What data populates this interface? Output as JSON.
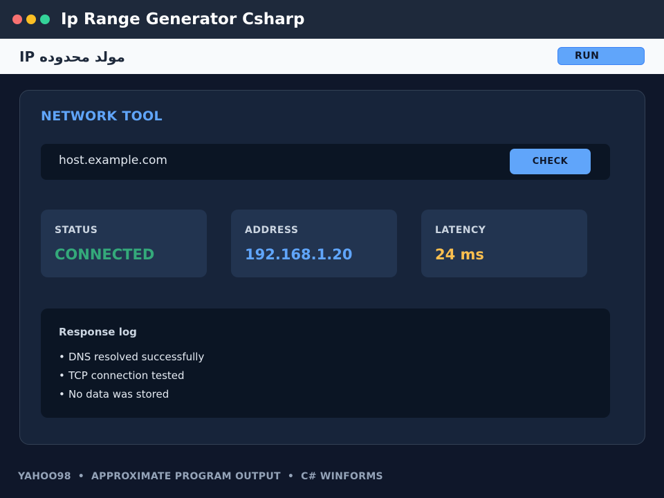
{
  "window": {
    "title": "Ip Range Generator Csharp"
  },
  "menubar": {
    "title": "مولد محدوده IP",
    "run_label": "RUN"
  },
  "panel": {
    "heading": "NETWORK TOOL",
    "host_value": "host.example.com",
    "check_label": "CHECK"
  },
  "stats": [
    {
      "label": "STATUS",
      "value": "CONNECTED",
      "color": "#34a97a"
    },
    {
      "label": "ADDRESS",
      "value": "192.168.1.20",
      "color": "#60a5fa"
    },
    {
      "label": "LATENCY",
      "value": "24 ms",
      "color": "#fbbf4f"
    }
  ],
  "log": {
    "title": "Response log",
    "bullet": "•",
    "items": [
      "DNS resolved successfully",
      "TCP connection tested",
      "No data was stored"
    ]
  },
  "footer": {
    "parts": [
      "YAHOO98",
      "APPROXIMATE PROGRAM OUTPUT",
      "C# WINFORMS"
    ],
    "separator": "•"
  },
  "colors": {
    "accent": "#60a5fa",
    "background": "#0f172a",
    "titlebar": "#1e293b",
    "dot_red": "#f87171",
    "dot_yellow": "#fbbf24",
    "dot_green": "#34d399"
  }
}
